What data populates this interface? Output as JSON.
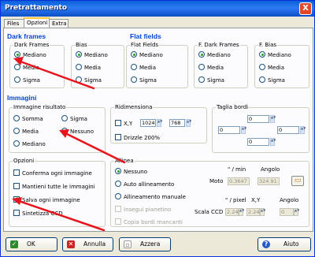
{
  "window": {
    "title": "Pretrattamento",
    "close_glyph": "X"
  },
  "tabs": [
    {
      "label": "Files"
    },
    {
      "label": "Opzioni"
    },
    {
      "label": "Extra"
    }
  ],
  "dark_frames": {
    "heading": "Dark frames",
    "dark": {
      "label": "Dark Frames",
      "options": [
        "Mediano",
        "Media",
        "Sigma"
      ],
      "selected": "Mediano"
    },
    "bias": {
      "label": "Bias",
      "options": [
        "Mediano",
        "Media",
        "Sigma"
      ],
      "selected": "Mediano"
    }
  },
  "flat_fields": {
    "heading": "Flat fields",
    "flat": {
      "label": "Flat Fields",
      "options": [
        "Mediano",
        "Media",
        "Sigma"
      ],
      "selected": "Mediano"
    },
    "f_dark": {
      "label": "F. Dark Frames",
      "options": [
        "Mediano",
        "Media",
        "Sigma"
      ],
      "selected": "Mediano"
    },
    "f_bias": {
      "label": "F. Bias",
      "options": [
        "Mediano",
        "Media",
        "Sigma"
      ],
      "selected": "Mediano"
    }
  },
  "immagini": {
    "heading": "Immagini",
    "risultato": {
      "label": "Immagine risultato",
      "somma": "Somma",
      "sigma": "Sigma",
      "media": "Media",
      "nessuno": "Nessuno",
      "mediano": "Mediano",
      "selected": "Nessuno"
    },
    "ridimensiona": {
      "label": "Ridimensiona",
      "xy_label": "X,Y",
      "x_value": "1024",
      "y_value": "768",
      "drizzle_label": "Drizzle 200%"
    },
    "taglia_bordi": {
      "label": "Taglia bordi",
      "top": "0",
      "left": "0",
      "right": "0",
      "bottom": "0"
    }
  },
  "opzioni": {
    "label": "Opzioni",
    "items": [
      {
        "label": "Conferma ogni immagine",
        "checked": false
      },
      {
        "label": "Mantieni tutte le immagini",
        "checked": false
      },
      {
        "label": "Salva ogni immagine",
        "checked": true
      },
      {
        "label": "Sintetizza CCD",
        "checked": false
      }
    ]
  },
  "allinea": {
    "label": "Allinea",
    "options": [
      "Nessuno",
      "Auto allineamento",
      "Allineamento manuale"
    ],
    "selected": "Nessuno",
    "inseguimento": "Insegui pianetino",
    "copia_bordi": "Copia bordi mancanti",
    "moto": {
      "label": "Moto",
      "rate_header": "\" / min",
      "angle_header": "Angolo",
      "rate_value": "0.3647",
      "angle_value": "324.91"
    },
    "scala": {
      "label": "Scala CCD",
      "pixel_header": "\" / pixel",
      "xy_header": "X,Y",
      "angle_header": "Angolo",
      "x_value": "2.24",
      "y_value": "2.24",
      "angle_value": "0"
    }
  },
  "buttons": {
    "ok": "OK",
    "annulla": "Annulla",
    "azzera": "Azzera",
    "aiuto": "Aiuto"
  },
  "annotation_color": "#e8141c"
}
